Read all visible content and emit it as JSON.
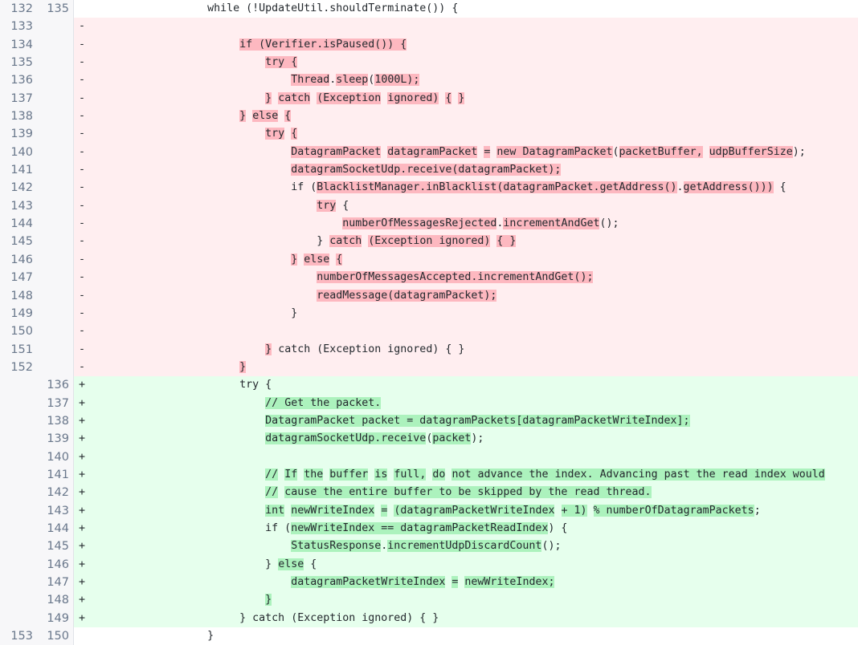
{
  "view": {
    "type": "unified-diff",
    "language": "java",
    "colors": {
      "context_bg": "#ffffff",
      "deletion_bg": "#ffeef0",
      "addition_bg": "#e6ffed",
      "deletion_word_highlight": "#fdb8c0",
      "addition_word_highlight": "#acf2bd",
      "gutter_bg": "#f7f7f9",
      "gutter_text": "#69778b",
      "code_text": "#24292e",
      "gutter_border": "#e1e4e8"
    },
    "markers": {
      "deletion": "-",
      "addition": "+",
      "context": ""
    }
  },
  "rows": [
    {
      "old": "132",
      "new": "135",
      "kind": "ctx",
      "marker": "",
      "segments": [
        {
          "text": "                    while (!UpdateUtil.shouldTerminate()) {",
          "hl": false
        }
      ]
    },
    {
      "old": "133",
      "new": "",
      "kind": "del",
      "marker": "-",
      "segments": [
        {
          "text": "",
          "hl": false
        }
      ]
    },
    {
      "old": "134",
      "new": "",
      "kind": "del",
      "marker": "-",
      "segments": [
        {
          "text": "                        ",
          "hl": false
        },
        {
          "text": "if (Verifier.isPaused()) {",
          "hl": true
        }
      ]
    },
    {
      "old": "135",
      "new": "",
      "kind": "del",
      "marker": "-",
      "segments": [
        {
          "text": "                            ",
          "hl": false
        },
        {
          "text": "try {",
          "hl": true
        }
      ]
    },
    {
      "old": "136",
      "new": "",
      "kind": "del",
      "marker": "-",
      "segments": [
        {
          "text": "                                ",
          "hl": false
        },
        {
          "text": "Thread",
          "hl": true
        },
        {
          "text": ".",
          "hl": false
        },
        {
          "text": "sleep",
          "hl": true
        },
        {
          "text": "(",
          "hl": false
        },
        {
          "text": "1000L);",
          "hl": true
        }
      ]
    },
    {
      "old": "137",
      "new": "",
      "kind": "del",
      "marker": "-",
      "segments": [
        {
          "text": "                            ",
          "hl": false
        },
        {
          "text": "}",
          "hl": true
        },
        {
          "text": " ",
          "hl": false
        },
        {
          "text": "catch",
          "hl": true
        },
        {
          "text": " ",
          "hl": false
        },
        {
          "text": "(Exception",
          "hl": true
        },
        {
          "text": " ",
          "hl": false
        },
        {
          "text": "ignored)",
          "hl": true
        },
        {
          "text": " ",
          "hl": false
        },
        {
          "text": "{",
          "hl": true
        },
        {
          "text": " ",
          "hl": false
        },
        {
          "text": "}",
          "hl": true
        }
      ]
    },
    {
      "old": "138",
      "new": "",
      "kind": "del",
      "marker": "-",
      "segments": [
        {
          "text": "                        ",
          "hl": false
        },
        {
          "text": "}",
          "hl": true
        },
        {
          "text": " ",
          "hl": false
        },
        {
          "text": "else",
          "hl": true
        },
        {
          "text": " ",
          "hl": false
        },
        {
          "text": "{",
          "hl": true
        }
      ]
    },
    {
      "old": "139",
      "new": "",
      "kind": "del",
      "marker": "-",
      "segments": [
        {
          "text": "                            ",
          "hl": false
        },
        {
          "text": "try",
          "hl": true
        },
        {
          "text": " ",
          "hl": false
        },
        {
          "text": "{",
          "hl": true
        }
      ]
    },
    {
      "old": "140",
      "new": "",
      "kind": "del",
      "marker": "-",
      "segments": [
        {
          "text": "                                ",
          "hl": false
        },
        {
          "text": "DatagramPacket",
          "hl": true
        },
        {
          "text": " ",
          "hl": false
        },
        {
          "text": "datagramPacket",
          "hl": true
        },
        {
          "text": " ",
          "hl": false
        },
        {
          "text": "=",
          "hl": true
        },
        {
          "text": " ",
          "hl": false
        },
        {
          "text": "new DatagramPacket",
          "hl": true
        },
        {
          "text": "(",
          "hl": false
        },
        {
          "text": "packetBuffer,",
          "hl": true
        },
        {
          "text": " ",
          "hl": false
        },
        {
          "text": "udpBufferSize",
          "hl": true
        },
        {
          "text": ");",
          "hl": false
        }
      ]
    },
    {
      "old": "141",
      "new": "",
      "kind": "del",
      "marker": "-",
      "segments": [
        {
          "text": "                                ",
          "hl": false
        },
        {
          "text": "datagramSocketUdp.receive(datagramPacket);",
          "hl": true
        }
      ]
    },
    {
      "old": "142",
      "new": "",
      "kind": "del",
      "marker": "-",
      "segments": [
        {
          "text": "                                if (",
          "hl": false
        },
        {
          "text": "BlacklistManager.inBlacklist(datagramPacket.getAddress()",
          "hl": true
        },
        {
          "text": ".",
          "hl": false
        },
        {
          "text": "getAddress()))",
          "hl": true
        },
        {
          "text": " {",
          "hl": false
        }
      ]
    },
    {
      "old": "143",
      "new": "",
      "kind": "del",
      "marker": "-",
      "segments": [
        {
          "text": "                                    ",
          "hl": false
        },
        {
          "text": "try",
          "hl": true
        },
        {
          "text": " {",
          "hl": false
        }
      ]
    },
    {
      "old": "144",
      "new": "",
      "kind": "del",
      "marker": "-",
      "segments": [
        {
          "text": "                                        ",
          "hl": false
        },
        {
          "text": "numberOfMessagesRejected",
          "hl": true
        },
        {
          "text": ".",
          "hl": false
        },
        {
          "text": "incrementAndGet",
          "hl": true
        },
        {
          "text": "();",
          "hl": false
        }
      ]
    },
    {
      "old": "145",
      "new": "",
      "kind": "del",
      "marker": "-",
      "segments": [
        {
          "text": "                                    } ",
          "hl": false
        },
        {
          "text": "catch",
          "hl": true
        },
        {
          "text": " ",
          "hl": false
        },
        {
          "text": "(Exception ignored)",
          "hl": true
        },
        {
          "text": " ",
          "hl": false
        },
        {
          "text": "{ }",
          "hl": true
        }
      ]
    },
    {
      "old": "146",
      "new": "",
      "kind": "del",
      "marker": "-",
      "segments": [
        {
          "text": "                                ",
          "hl": false
        },
        {
          "text": "}",
          "hl": true
        },
        {
          "text": " ",
          "hl": false
        },
        {
          "text": "else",
          "hl": true
        },
        {
          "text": " ",
          "hl": false
        },
        {
          "text": "{",
          "hl": true
        }
      ]
    },
    {
      "old": "147",
      "new": "",
      "kind": "del",
      "marker": "-",
      "segments": [
        {
          "text": "                                    ",
          "hl": false
        },
        {
          "text": "numberOfMessagesAccepted.incrementAndGet();",
          "hl": true
        }
      ]
    },
    {
      "old": "148",
      "new": "",
      "kind": "del",
      "marker": "-",
      "segments": [
        {
          "text": "                                    ",
          "hl": false
        },
        {
          "text": "readMessage(datagramPacket);",
          "hl": true
        }
      ]
    },
    {
      "old": "149",
      "new": "",
      "kind": "del",
      "marker": "-",
      "segments": [
        {
          "text": "                                }",
          "hl": false
        }
      ]
    },
    {
      "old": "150",
      "new": "",
      "kind": "del",
      "marker": "-",
      "segments": [
        {
          "text": "",
          "hl": false
        }
      ]
    },
    {
      "old": "151",
      "new": "",
      "kind": "del",
      "marker": "-",
      "segments": [
        {
          "text": "                            ",
          "hl": false
        },
        {
          "text": "}",
          "hl": true
        },
        {
          "text": " catch (Exception ignored) { }",
          "hl": false
        }
      ]
    },
    {
      "old": "152",
      "new": "",
      "kind": "del",
      "marker": "-",
      "segments": [
        {
          "text": "                        ",
          "hl": false
        },
        {
          "text": "}",
          "hl": true
        }
      ]
    },
    {
      "old": "",
      "new": "136",
      "kind": "add",
      "marker": "+",
      "segments": [
        {
          "text": "                        try {",
          "hl": false
        }
      ]
    },
    {
      "old": "",
      "new": "137",
      "kind": "add",
      "marker": "+",
      "segments": [
        {
          "text": "                            ",
          "hl": false
        },
        {
          "text": "// Get the packet.",
          "hl": true
        }
      ]
    },
    {
      "old": "",
      "new": "138",
      "kind": "add",
      "marker": "+",
      "segments": [
        {
          "text": "                            ",
          "hl": false
        },
        {
          "text": "DatagramPacket packet = datagramPackets[datagramPacketWriteIndex];",
          "hl": true
        }
      ]
    },
    {
      "old": "",
      "new": "139",
      "kind": "add",
      "marker": "+",
      "segments": [
        {
          "text": "                            ",
          "hl": false
        },
        {
          "text": "datagramSocketUdp.receive",
          "hl": true
        },
        {
          "text": "(",
          "hl": false
        },
        {
          "text": "packet",
          "hl": true
        },
        {
          "text": ");",
          "hl": false
        }
      ]
    },
    {
      "old": "",
      "new": "140",
      "kind": "add",
      "marker": "+",
      "segments": [
        {
          "text": "",
          "hl": false
        }
      ]
    },
    {
      "old": "",
      "new": "141",
      "kind": "add",
      "marker": "+",
      "segments": [
        {
          "text": "                            ",
          "hl": false
        },
        {
          "text": "//",
          "hl": true
        },
        {
          "text": " ",
          "hl": false
        },
        {
          "text": "If",
          "hl": true
        },
        {
          "text": " ",
          "hl": false
        },
        {
          "text": "the",
          "hl": true
        },
        {
          "text": " ",
          "hl": false
        },
        {
          "text": "buffer",
          "hl": true
        },
        {
          "text": " ",
          "hl": false
        },
        {
          "text": "is",
          "hl": true
        },
        {
          "text": " ",
          "hl": false
        },
        {
          "text": "full,",
          "hl": true
        },
        {
          "text": " ",
          "hl": false
        },
        {
          "text": "do",
          "hl": true
        },
        {
          "text": " ",
          "hl": false
        },
        {
          "text": "not advance the index. Advancing past the read index would",
          "hl": true
        }
      ]
    },
    {
      "old": "",
      "new": "142",
      "kind": "add",
      "marker": "+",
      "segments": [
        {
          "text": "                            ",
          "hl": false
        },
        {
          "text": "//",
          "hl": true
        },
        {
          "text": " ",
          "hl": false
        },
        {
          "text": "cause the entire buffer to be skipped by the read thread.",
          "hl": true
        }
      ]
    },
    {
      "old": "",
      "new": "143",
      "kind": "add",
      "marker": "+",
      "segments": [
        {
          "text": "                            ",
          "hl": false
        },
        {
          "text": "int",
          "hl": true
        },
        {
          "text": " ",
          "hl": false
        },
        {
          "text": "newWriteIndex",
          "hl": true
        },
        {
          "text": " ",
          "hl": false
        },
        {
          "text": "=",
          "hl": true
        },
        {
          "text": " ",
          "hl": false
        },
        {
          "text": "(datagramPacketWriteIndex",
          "hl": true
        },
        {
          "text": " ",
          "hl": false
        },
        {
          "text": "+ 1)",
          "hl": true
        },
        {
          "text": " ",
          "hl": false
        },
        {
          "text": "% numberOfDatagramPackets",
          "hl": true
        },
        {
          "text": ";",
          "hl": false
        }
      ]
    },
    {
      "old": "",
      "new": "144",
      "kind": "add",
      "marker": "+",
      "segments": [
        {
          "text": "                            if (",
          "hl": false
        },
        {
          "text": "newWriteIndex == datagramPacketReadIndex",
          "hl": true
        },
        {
          "text": ") {",
          "hl": false
        }
      ]
    },
    {
      "old": "",
      "new": "145",
      "kind": "add",
      "marker": "+",
      "segments": [
        {
          "text": "                                ",
          "hl": false
        },
        {
          "text": "StatusResponse",
          "hl": true
        },
        {
          "text": ".",
          "hl": false
        },
        {
          "text": "incrementUdpDiscardCount",
          "hl": true
        },
        {
          "text": "();",
          "hl": false
        }
      ]
    },
    {
      "old": "",
      "new": "146",
      "kind": "add",
      "marker": "+",
      "segments": [
        {
          "text": "                            } ",
          "hl": false
        },
        {
          "text": "else",
          "hl": true
        },
        {
          "text": " {",
          "hl": false
        }
      ]
    },
    {
      "old": "",
      "new": "147",
      "kind": "add",
      "marker": "+",
      "segments": [
        {
          "text": "                                ",
          "hl": false
        },
        {
          "text": "datagramPacketWriteIndex",
          "hl": true
        },
        {
          "text": " ",
          "hl": false
        },
        {
          "text": "=",
          "hl": true
        },
        {
          "text": " ",
          "hl": false
        },
        {
          "text": "newWriteIndex;",
          "hl": true
        }
      ]
    },
    {
      "old": "",
      "new": "148",
      "kind": "add",
      "marker": "+",
      "segments": [
        {
          "text": "                            ",
          "hl": false
        },
        {
          "text": "}",
          "hl": true
        }
      ]
    },
    {
      "old": "",
      "new": "149",
      "kind": "add",
      "marker": "+",
      "segments": [
        {
          "text": "                        } catch (Exception ignored) { }",
          "hl": false
        }
      ]
    },
    {
      "old": "153",
      "new": "150",
      "kind": "ctx last",
      "marker": "",
      "segments": [
        {
          "text": "                    }",
          "hl": false
        }
      ]
    }
  ]
}
